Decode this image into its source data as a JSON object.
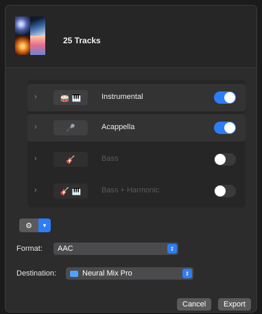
{
  "header": {
    "title": "25 Tracks",
    "artwork": [
      "album-art-1",
      "album-art-2",
      "album-art-3",
      "album-art-4"
    ]
  },
  "stems": [
    {
      "label": "Instrumental",
      "icons": "🥁 🎹",
      "enabled": true,
      "active": true
    },
    {
      "label": "Acappella",
      "icons": "🎤",
      "enabled": true,
      "active": true
    },
    {
      "label": "Bass",
      "icons": "🎸",
      "enabled": false,
      "active": false
    },
    {
      "label": "Bass + Harmonic",
      "icons": "🎸 🎹",
      "enabled": false,
      "active": false
    }
  ],
  "options": {
    "gear_icon": "gear-icon",
    "caret_icon": "chevron-down-icon"
  },
  "format": {
    "label": "Format:",
    "value": "AAC"
  },
  "destination": {
    "label": "Destination:",
    "value": "Neural Mix Pro"
  },
  "buttons": {
    "cancel": "Cancel",
    "export": "Export"
  },
  "colors": {
    "accent": "#2d7df6",
    "window": "#2c2c2d"
  }
}
